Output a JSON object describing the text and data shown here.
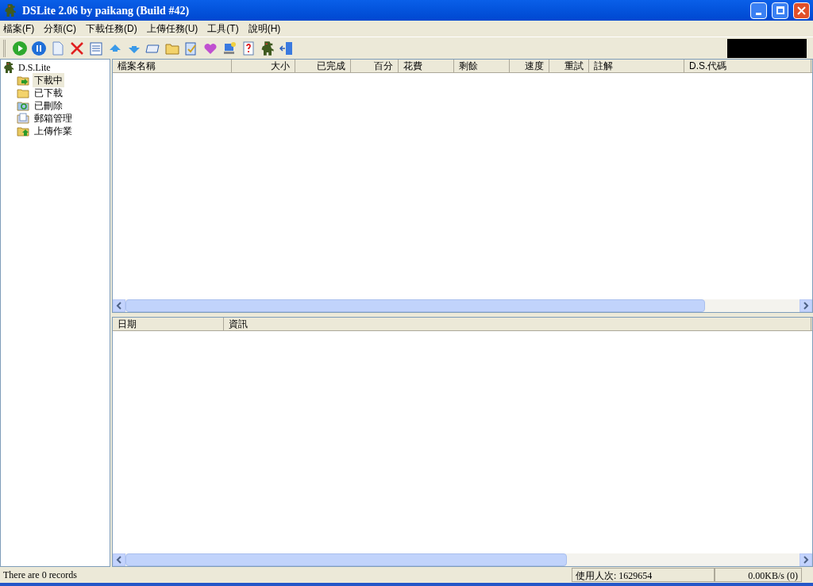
{
  "window": {
    "title": "DSLite 2.06 by paikang (Build #42)"
  },
  "menu": [
    "檔案(F)",
    "分類(C)",
    "下載任務(D)",
    "上傳任務(U)",
    "工具(T)",
    "說明(H)"
  ],
  "tree": {
    "label": "D.S.Lite",
    "children": [
      {
        "label": "下載中",
        "selected": true,
        "kind": "downloading"
      },
      {
        "label": "已下載",
        "selected": false,
        "kind": "folder"
      },
      {
        "label": "已刪除",
        "selected": false,
        "kind": "recycle"
      },
      {
        "label": "郵箱管理",
        "selected": false,
        "kind": "mail"
      },
      {
        "label": "上傳作業",
        "selected": false,
        "kind": "upload"
      }
    ]
  },
  "task_table": {
    "columns": [
      {
        "label": "檔案名稱"
      },
      {
        "label": "大小"
      },
      {
        "label": "已完成"
      },
      {
        "label": "百分"
      },
      {
        "label": "花費"
      },
      {
        "label": "剩餘"
      },
      {
        "label": "速度"
      },
      {
        "label": "重試"
      },
      {
        "label": "註解"
      },
      {
        "label": "D.S.代碼"
      }
    ]
  },
  "log_table": {
    "columns": [
      {
        "label": "日期"
      },
      {
        "label": "資訊"
      }
    ]
  },
  "status_bar": {
    "records": "There are 0 records",
    "visits": "使用人次: 1629654",
    "speed": "0.00KB/s (0)"
  }
}
